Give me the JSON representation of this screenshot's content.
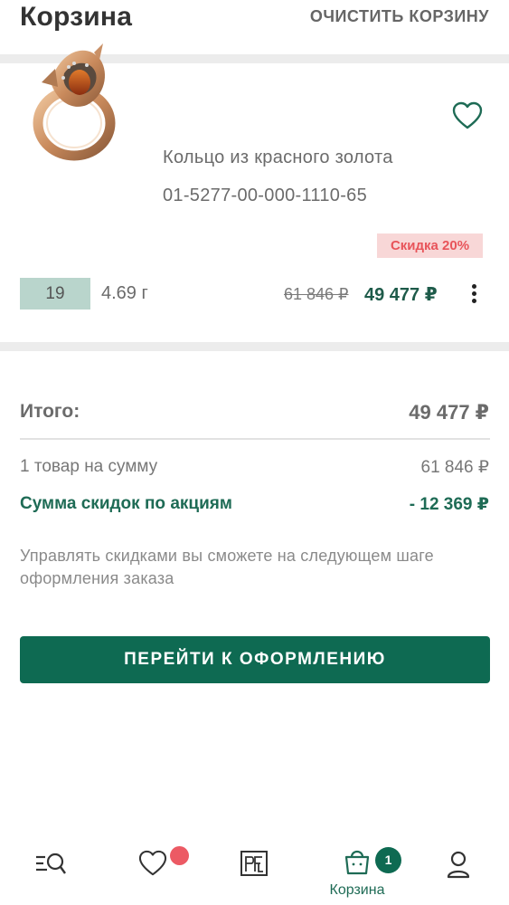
{
  "header": {
    "title": "Корзина",
    "clear_label": "ОЧИСТИТЬ КОРЗИНУ"
  },
  "cart_item": {
    "name": "Кольцо из красного золота",
    "sku": "01-5277-00-000-1110-65",
    "discount_badge": "Скидка 20%",
    "size": "19",
    "weight": "4.69 г",
    "old_price": "61 846 ₽",
    "new_price": "49 477 ₽",
    "image_icon": "gold-ring-photo",
    "favorite_icon": "heart-outline-icon",
    "more_icon": "vertical-dots-icon"
  },
  "summary": {
    "total_label": "Итого:",
    "total_value": "49 477 ₽",
    "items_label": "1 товар на сумму",
    "items_value": "61 846 ₽",
    "discount_label": "Сумма скидок по акциям",
    "discount_value": "- 12 369 ₽",
    "note": "Управлять скидками вы сможете на следующем шаге оформления заказа"
  },
  "checkout": {
    "button_label": "ПЕРЕЙТИ К ОФОРМЛЕНИЮ"
  },
  "bottom_nav": {
    "items": [
      {
        "icon": "catalog-search-icon",
        "label": ""
      },
      {
        "icon": "heart-icon",
        "label": ""
      },
      {
        "icon": "brand-logo-icon",
        "label": ""
      },
      {
        "icon": "shopping-bag-icon",
        "label": "Корзина",
        "badge": "1"
      },
      {
        "icon": "profile-icon",
        "label": ""
      }
    ]
  },
  "colors": {
    "accent": "#0e6a52",
    "discount_badge_bg": "#f8d7d7",
    "discount_badge_text": "#e8545a",
    "size_bg": "#b9d5cc",
    "notification_dot": "#ec5a64"
  }
}
